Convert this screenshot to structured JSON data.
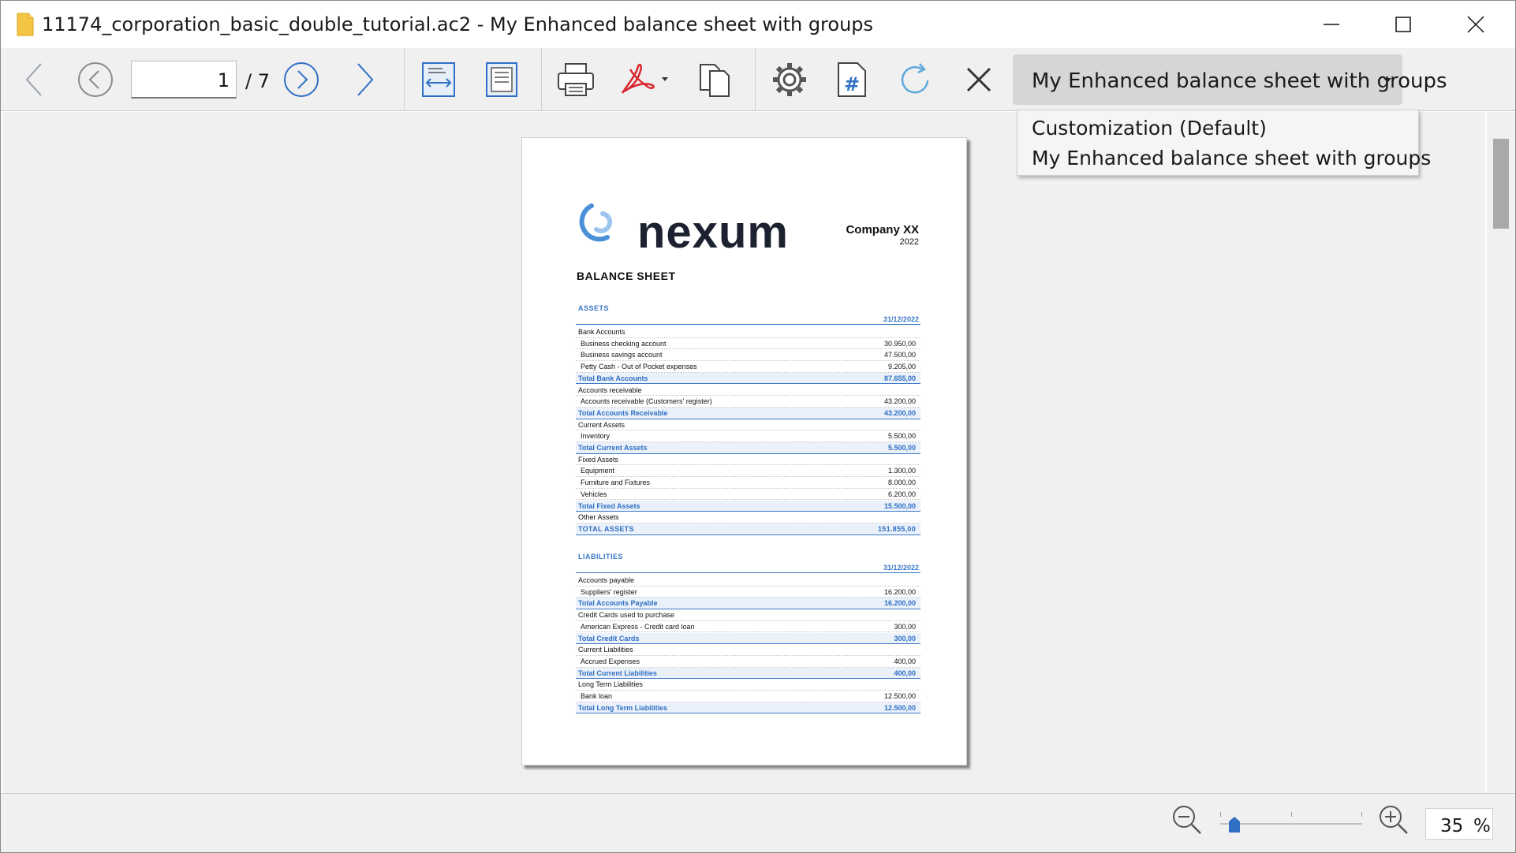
{
  "window": {
    "title": "11174_corporation_basic_double_tutorial.ac2 - My Enhanced balance sheet with groups"
  },
  "toolbar": {
    "current_page": "1",
    "total_pages": "/ 7",
    "customization_selected": "My Enhanced balance sheet with groups",
    "customization_options": [
      "Customization (Default)",
      "My Enhanced balance sheet with groups"
    ]
  },
  "document": {
    "logo_text": "nexum",
    "company": "Company XX",
    "year": "2022",
    "title": "BALANCE SHEET",
    "assets": {
      "heading": "ASSETS",
      "date": "31/12/2022",
      "rows": [
        {
          "label": "Bank Accounts",
          "amount": "",
          "type": "group"
        },
        {
          "label": "Business checking account",
          "amount": "30.950,00",
          "type": "acc"
        },
        {
          "label": "Business savings account",
          "amount": "47.500,00",
          "type": "acc"
        },
        {
          "label": "Petty Cash - Out of Pocket expenses",
          "amount": "9.205,00",
          "type": "acc"
        },
        {
          "label": "Total Bank Accounts",
          "amount": "87.655,00",
          "type": "total"
        },
        {
          "label": "Accounts receivable",
          "amount": "",
          "type": "group"
        },
        {
          "label": "Accounts receivable (Customers' register)",
          "amount": "43.200,00",
          "type": "acc"
        },
        {
          "label": "Total Accounts Receivable",
          "amount": "43.200,00",
          "type": "total"
        },
        {
          "label": "Current Assets",
          "amount": "",
          "type": "group"
        },
        {
          "label": "Inventory",
          "amount": "5.500,00",
          "type": "acc"
        },
        {
          "label": "Total Current Assets",
          "amount": "5.500,00",
          "type": "total"
        },
        {
          "label": "Fixed Assets",
          "amount": "",
          "type": "group"
        },
        {
          "label": "Equipment",
          "amount": "1.300,00",
          "type": "acc"
        },
        {
          "label": "Furniture and Fixtures",
          "amount": "8.000,00",
          "type": "acc"
        },
        {
          "label": "Vehicles",
          "amount": "6.200,00",
          "type": "acc"
        },
        {
          "label": "Total Fixed Assets",
          "amount": "15.500,00",
          "type": "total"
        },
        {
          "label": "Other Assets",
          "amount": "",
          "type": "group"
        },
        {
          "label": "TOTAL ASSETS",
          "amount": "151.855,00",
          "type": "grand"
        }
      ]
    },
    "liabilities": {
      "heading": "LIABILITIES",
      "date": "31/12/2022",
      "rows": [
        {
          "label": "Accounts payable",
          "amount": "",
          "type": "group"
        },
        {
          "label": "Suppliers' register",
          "amount": "16.200,00",
          "type": "acc"
        },
        {
          "label": "Total Accounts Payable",
          "amount": "16.200,00",
          "type": "total"
        },
        {
          "label": "Credit Cards used to purchase",
          "amount": "",
          "type": "group"
        },
        {
          "label": "American Express - Credit card loan",
          "amount": "300,00",
          "type": "acc"
        },
        {
          "label": "Total Credit Cards",
          "amount": "300,00",
          "type": "total"
        },
        {
          "label": "Current Liabilities",
          "amount": "",
          "type": "group"
        },
        {
          "label": "Accrued Expenses",
          "amount": "400,00",
          "type": "acc"
        },
        {
          "label": "Total Current Liabilities",
          "amount": "400,00",
          "type": "total"
        },
        {
          "label": "Long Term Liabilities",
          "amount": "",
          "type": "group"
        },
        {
          "label": "Bank loan",
          "amount": "12.500,00",
          "type": "acc"
        },
        {
          "label": "Total Long Term Liabilities",
          "amount": "12.500,00",
          "type": "total"
        }
      ]
    }
  },
  "statusbar": {
    "zoom_value": "35",
    "zoom_unit": "%",
    "zoom_fraction": 0.1
  },
  "colors": {
    "accent": "#2f6fc4",
    "section_blue": "#3a78c8",
    "toolbar_bg": "#f0f0f0",
    "combo_bg": "#d6d6d6"
  }
}
